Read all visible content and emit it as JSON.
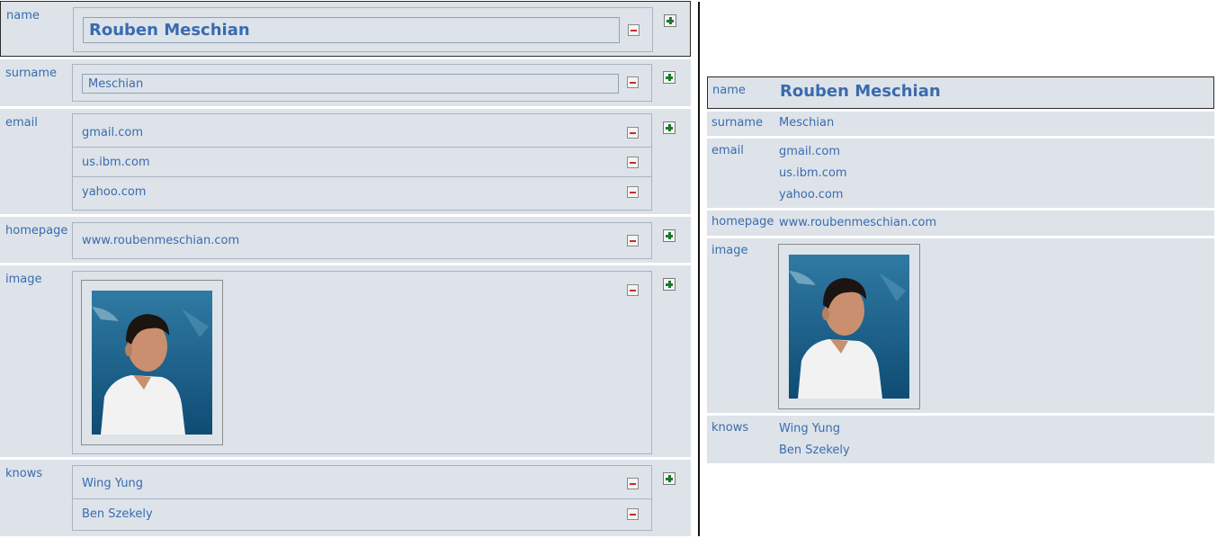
{
  "labels": {
    "name": "name",
    "surname": "surname",
    "email": "email",
    "homepage": "homepage",
    "image": "image",
    "knows": "knows"
  },
  "person": {
    "name": "Rouben Meschian",
    "surname": "Meschian",
    "emails": [
      "gmail.com",
      "us.ibm.com",
      "yahoo.com"
    ],
    "homepage": "www.roubenmeschian.com",
    "knows": [
      "Wing Yung",
      "Ben Szekely"
    ]
  },
  "icons": {
    "add": "plus-icon",
    "remove": "minus-icon"
  },
  "colors": {
    "text": "#3a6bb0",
    "panel": "#dde3e9",
    "add": "#1b7a2e",
    "remove": "#cc2a2a"
  }
}
